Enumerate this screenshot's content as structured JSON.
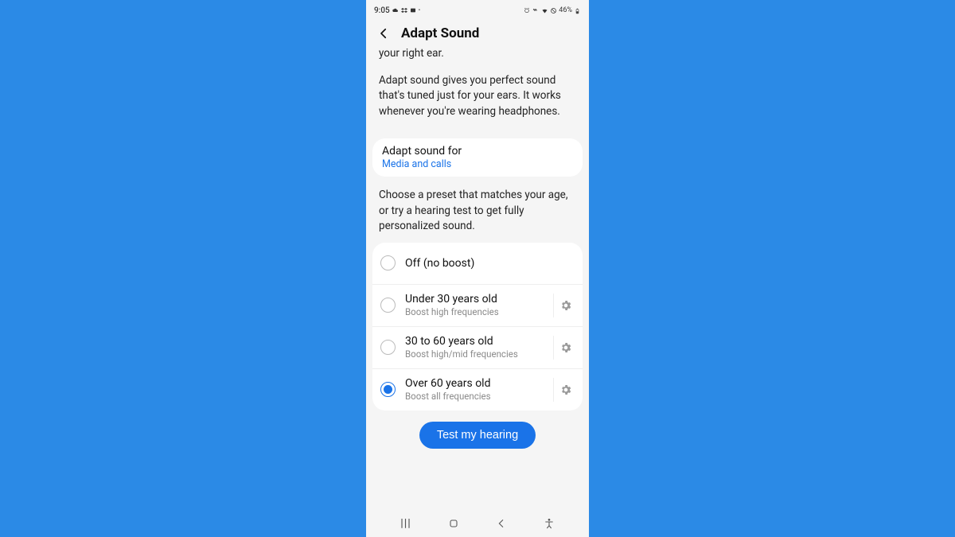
{
  "status": {
    "time": "9:05",
    "left_icons": [
      "cloud-icon",
      "dropbox-icon",
      "image-icon",
      "dot-icon"
    ],
    "right_text": "46%",
    "right_icons": [
      "alarm-icon",
      "vibrate-icon",
      "wifi-icon",
      "no-data-icon",
      "battery-icon"
    ]
  },
  "header": {
    "title": "Adapt Sound"
  },
  "intro": {
    "partial_line": "your right ear.",
    "paragraph": "Adapt sound gives you perfect sound that's tuned just for your ears. It works whenever you're wearing headphones."
  },
  "setting": {
    "title": "Adapt sound for",
    "value": "Media and calls"
  },
  "choose_text": "Choose a preset that matches your age, or try a hearing test to get fully personalized sound.",
  "options": {
    "off": {
      "label": "Off (no boost)"
    },
    "u30": {
      "label": "Under 30 years old",
      "sub": "Boost high frequencies"
    },
    "mid": {
      "label": "30 to 60 years old",
      "sub": "Boost high/mid frequencies"
    },
    "o60": {
      "label": "Over 60 years old",
      "sub": "Boost all frequencies"
    },
    "selected": "o60"
  },
  "cta": {
    "label": "Test my hearing"
  }
}
